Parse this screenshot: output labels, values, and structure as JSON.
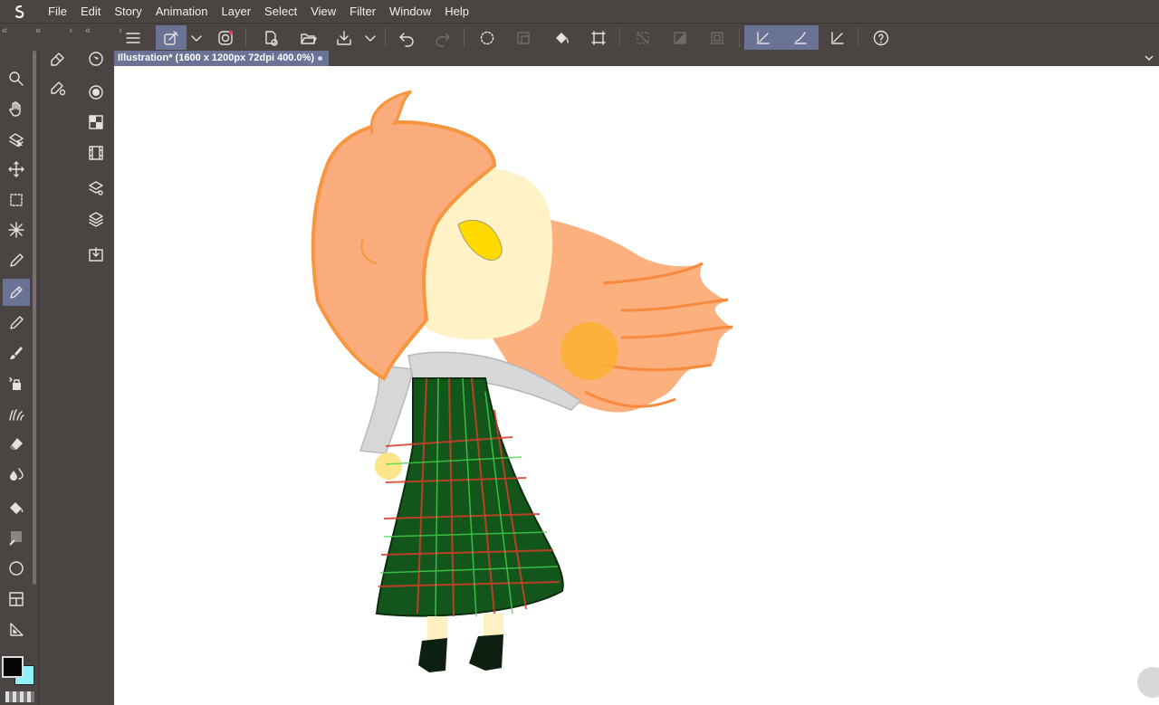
{
  "menu": {
    "items": [
      "File",
      "Edit",
      "Story",
      "Animation",
      "Layer",
      "Select",
      "View",
      "Filter",
      "Window",
      "Help"
    ]
  },
  "toolbar": {
    "buttons": [
      "menu-icon",
      "reference-layer-icon",
      "dropdown-chevron-icon",
      "companion-mode-icon",
      "new-canvas-icon",
      "open-file-icon",
      "save-icon",
      "save-options-chevron-icon",
      "undo-icon",
      "redo-icon",
      "selection-launcher-icon",
      "crop-icon",
      "fill-icon",
      "transform-icon",
      "clear-selection-icon",
      "invert-selection-icon",
      "border-icon",
      "snap-ruler-icon",
      "snap-special-ruler-icon",
      "snap-grid-icon",
      "help-icon"
    ]
  },
  "document": {
    "tab_label": "Illustration* (1600 x 1200px 72dpi 400.0%)"
  },
  "tools": [
    "zoom-icon",
    "hand-icon",
    "operation-icon",
    "move-layer-icon",
    "selection-icon",
    "auto-select-icon",
    "eyedropper-icon",
    "pen-icon",
    "pencil-icon",
    "brush-icon",
    "airbrush-icon",
    "decoration-icon",
    "eraser-icon",
    "blend-icon",
    "fill-bucket-icon",
    "gradient-icon",
    "figure-icon",
    "frame-border-icon",
    "ruler-icon"
  ],
  "colors": {
    "main_color": "#050505",
    "sub_color": "#8ff0f8",
    "accent": "#6a7296",
    "panel_bg": "#4a4543"
  }
}
